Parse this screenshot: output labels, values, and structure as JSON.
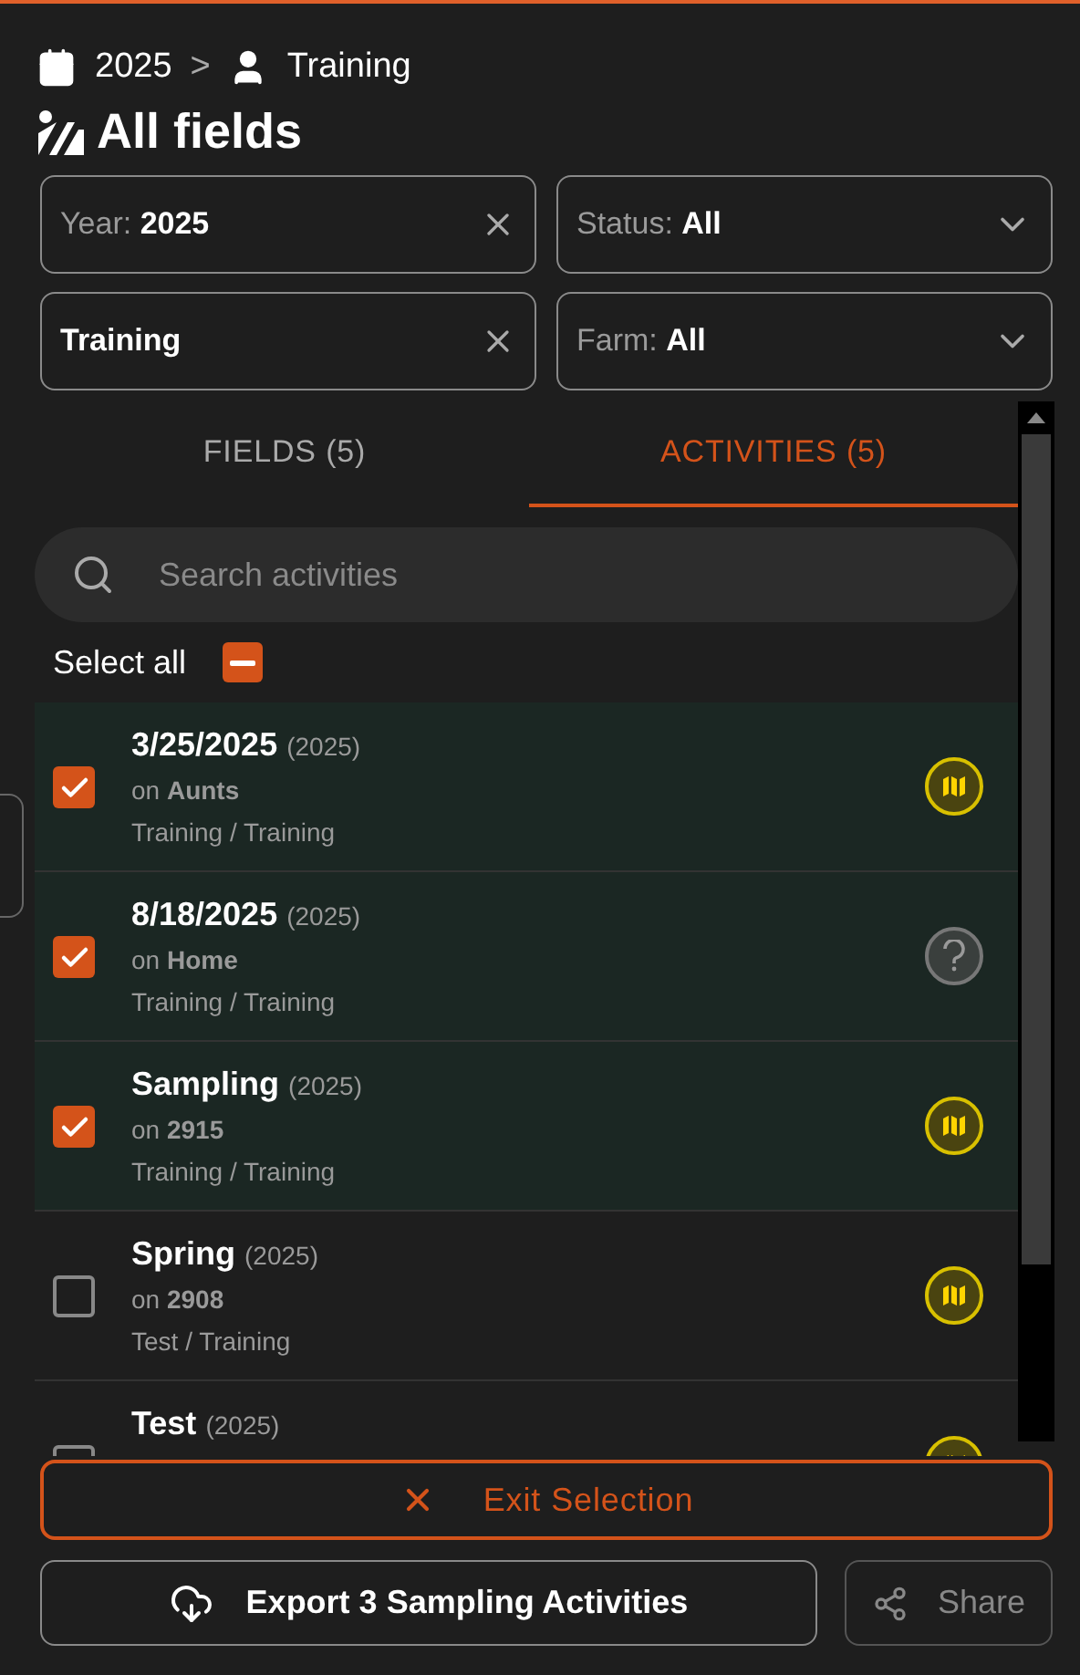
{
  "breadcrumb": {
    "season": "2025",
    "separator": ">",
    "user": "Training"
  },
  "title": "All fields",
  "filters": [
    {
      "label": "Year:",
      "value": "2025",
      "kind": "clear"
    },
    {
      "label": "Status:",
      "value": "All",
      "kind": "dropdown"
    },
    {
      "value": "Training",
      "kind": "clear"
    },
    {
      "label": "Farm:",
      "value": "All",
      "kind": "dropdown"
    }
  ],
  "tabs": [
    {
      "label": "FIELDS (5)",
      "selected": false
    },
    {
      "label": "ACTIVITIES (5)",
      "selected": true
    }
  ],
  "search": {
    "placeholder": "Search activities"
  },
  "select_all": {
    "label": "Select all",
    "indeterminate": true
  },
  "activities": [
    {
      "title": "3/25/2025",
      "year": "(2025)",
      "location": "on **Aunts**",
      "detail": "Training / Training",
      "checked": true,
      "kind": "map"
    },
    {
      "title": "8/18/2025",
      "year": "(2025)",
      "location": "on **Home**",
      "detail": "Training / Training",
      "checked": true,
      "kind": "unknown"
    },
    {
      "title": "Sampling",
      "year": "(2025)",
      "location": "on **2915**",
      "detail": "Training / Training",
      "checked": true,
      "kind": "map"
    },
    {
      "title": "Spring",
      "year": "(2025)",
      "location": "on **2908**",
      "detail": "Test / Training",
      "checked": false,
      "kind": "map"
    },
    {
      "title": "Test",
      "year": "(2025)",
      "checked": false,
      "kind": "map"
    }
  ],
  "exit_button": "Exit Selection",
  "export_button": "Export 3 Sampling Activities",
  "share_button": {
    "label": "Share",
    "disabled": true
  }
}
